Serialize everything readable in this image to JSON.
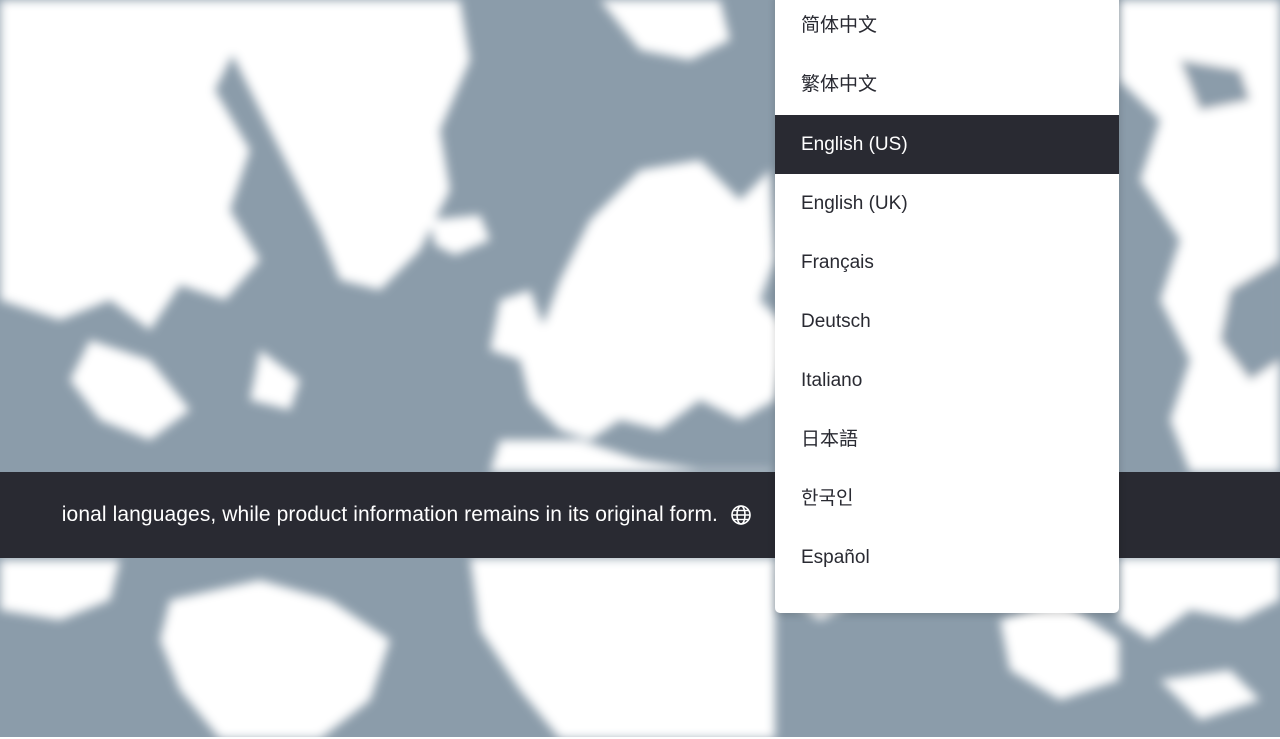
{
  "colors": {
    "map_water": "#8b9caa",
    "map_land": "#ffffff",
    "banner_bg": "#292a32",
    "selected_bg": "#292a32",
    "dropdown_bg": "#ffffff"
  },
  "banner": {
    "text": "ional languages, while product information remains in its original form.",
    "icon": "globe-icon"
  },
  "language_menu": {
    "selected": "English (US)",
    "items": [
      {
        "label": "简体中文"
      },
      {
        "label": "繁体中文"
      },
      {
        "label": "English (US)"
      },
      {
        "label": "English (UK)"
      },
      {
        "label": "Français"
      },
      {
        "label": "Deutsch"
      },
      {
        "label": "Italiano"
      },
      {
        "label": "日本語"
      },
      {
        "label": "한국인"
      },
      {
        "label": "Español"
      }
    ]
  }
}
